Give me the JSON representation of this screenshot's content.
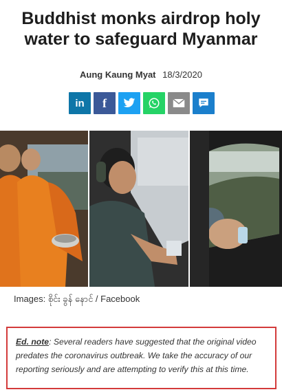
{
  "article": {
    "headline": "Buddhist monks airdrop holy water to safeguard Myanmar",
    "author": "Aung Kaung Myat",
    "date": "18/3/2020"
  },
  "share": [
    {
      "name": "linkedin",
      "glyph": "in",
      "color": "#0e76a8"
    },
    {
      "name": "facebook",
      "glyph": "f",
      "color": "#3b5998"
    },
    {
      "name": "twitter",
      "glyph": "",
      "color": "#1da1f2"
    },
    {
      "name": "whatsapp",
      "glyph": "",
      "color": "#25d366"
    },
    {
      "name": "email",
      "glyph": "",
      "color": "#8a8a8a"
    },
    {
      "name": "comment",
      "glyph": "",
      "color": "#1b7fcc"
    }
  ],
  "photo": {
    "caption": "Images: စိုင်း ခွန် နောင် / Facebook"
  },
  "ed_note": {
    "label": "Ed. note",
    "text": ": Several readers have suggested that the original video predates the coronavirus outbreak. We take the accuracy of our reporting seriously and are attempting to verify this at this time."
  }
}
